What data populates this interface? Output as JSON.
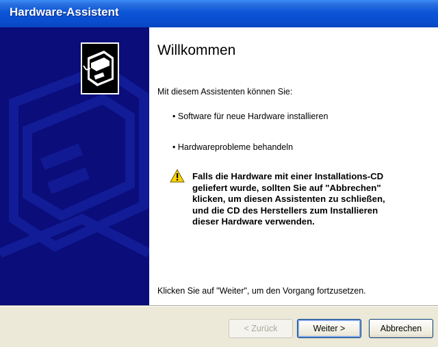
{
  "window": {
    "title": "Hardware-Assistent"
  },
  "main": {
    "heading": "Willkommen",
    "intro": "Mit diesem Assistenten können Sie:",
    "bullets": [
      "Software für neue Hardware installieren",
      "Hardwareprobleme behandeln"
    ],
    "warning_lines": [
      "Falls die Hardware mit einer Installations-CD",
      "geliefert wurde, sollten Sie auf \"Abbrechen\"",
      "klicken, um diesen Assistenten zu schließen,",
      "und die CD des Herstellers zum Installieren",
      "dieser Hardware verwenden."
    ],
    "footer": "Klicken Sie auf \"Weiter\", um den Vorgang fortzusetzen."
  },
  "buttons": {
    "back": "< Zurück",
    "next": "Weiter >",
    "cancel": "Abbrechen"
  },
  "icons": {
    "sidebar_icon": "hardware-box-icon",
    "warning_icon": "warning-icon"
  },
  "colors": {
    "titlebar": "#0a4ed0",
    "sidebar": "#0a0d7a",
    "dialog_bg": "#ece9d8"
  }
}
